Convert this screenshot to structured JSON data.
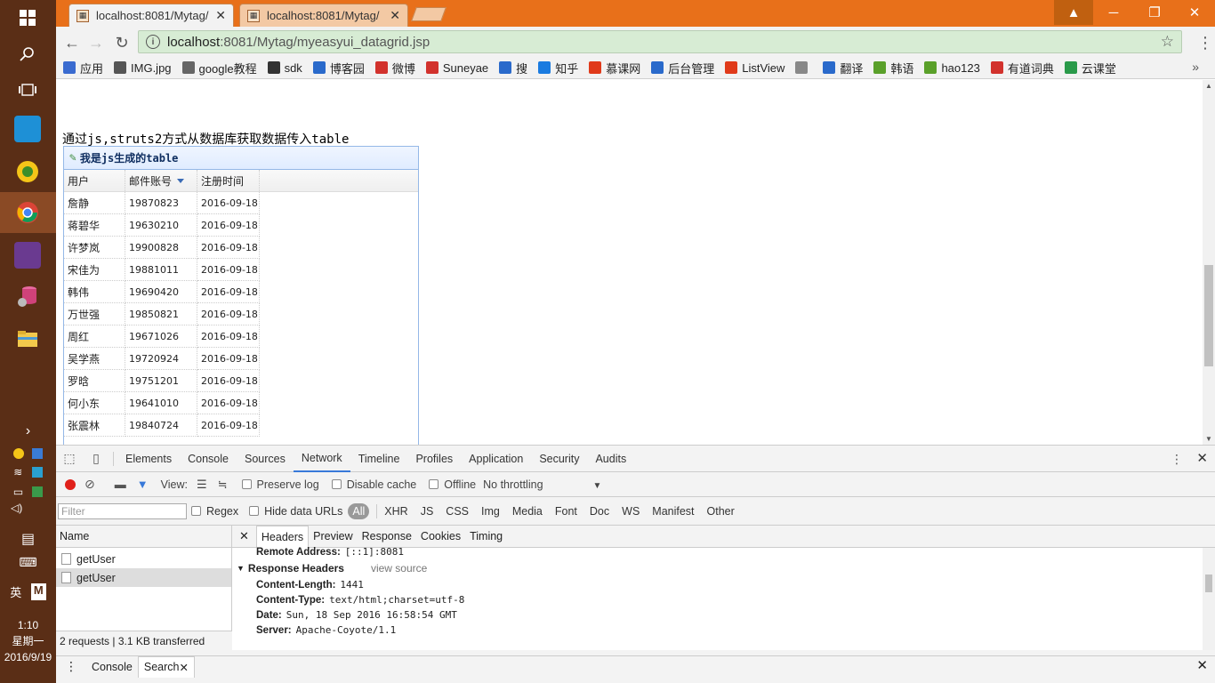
{
  "taskbar": {
    "time": "1:10",
    "weekday": "星期一",
    "date": "2016/9/19",
    "ime": "英",
    "ime2": "M"
  },
  "tabs": [
    {
      "title": "localhost:8081/Mytag/"
    },
    {
      "title": "localhost:8081/Mytag/"
    }
  ],
  "address": {
    "host": "localhost",
    "path": ":8081/Mytag/myeasyui_datagrid.jsp"
  },
  "bookmarks": [
    {
      "label": "应用",
      "color": "#3a6bd0"
    },
    {
      "label": "IMG.jpg",
      "color": "#555555"
    },
    {
      "label": "google教程",
      "color": "#666666"
    },
    {
      "label": "sdk",
      "color": "#333333"
    },
    {
      "label": "博客园",
      "color": "#2a6acb"
    },
    {
      "label": "微博",
      "color": "#d2322d"
    },
    {
      "label": "Suneyae",
      "color": "#d2322d"
    },
    {
      "label": "搜",
      "color": "#2a6acb"
    },
    {
      "label": "知乎",
      "color": "#1a7be0"
    },
    {
      "label": "慕课网",
      "color": "#e03a1a"
    },
    {
      "label": "后台管理",
      "color": "#2a6acb"
    },
    {
      "label": "ListView",
      "color": "#e03a1a"
    },
    {
      "label": "",
      "color": "#888888"
    },
    {
      "label": "翻译",
      "color": "#2a6acb"
    },
    {
      "label": "韩语",
      "color": "#5aa02a"
    },
    {
      "label": "hao123",
      "color": "#5aa02a"
    },
    {
      "label": "有道词典",
      "color": "#d2322d"
    },
    {
      "label": "云课堂",
      "color": "#2a9a4a"
    }
  ],
  "page": {
    "heading": "通过js,struts2方式从数据库获取数据传入table",
    "panel_title": "我是js生成的table",
    "columns": [
      "用户",
      "邮件账号",
      "注册时间"
    ],
    "rows": [
      [
        "詹静",
        "19870823",
        "2016-09-18"
      ],
      [
        "蒋碧华",
        "19630210",
        "2016-09-18"
      ],
      [
        "许梦岚",
        "19900828",
        "2016-09-18"
      ],
      [
        "宋佳为",
        "19881011",
        "2016-09-18"
      ],
      [
        "韩伟",
        "19690420",
        "2016-09-18"
      ],
      [
        "万世强",
        "19850821",
        "2016-09-18"
      ],
      [
        "周红",
        "19671026",
        "2016-09-18"
      ],
      [
        "吴学燕",
        "19720924",
        "2016-09-18"
      ],
      [
        "罗晗",
        "19751201",
        "2016-09-18"
      ],
      [
        "何小东",
        "19641010",
        "2016-09-18"
      ],
      [
        "张震林",
        "19840724",
        "2016-09-18"
      ]
    ]
  },
  "devtools": {
    "tabs": [
      "Elements",
      "Console",
      "Sources",
      "Network",
      "Timeline",
      "Profiles",
      "Application",
      "Security",
      "Audits"
    ],
    "active_tab": "Network",
    "view_label": "View:",
    "preserve_log": "Preserve log",
    "disable_cache": "Disable cache",
    "offline": "Offline",
    "throttling": "No throttling",
    "filter_placeholder": "Filter",
    "regex": "Regex",
    "hide_data_urls": "Hide data URLs",
    "all": "All",
    "filter_types": [
      "XHR",
      "JS",
      "CSS",
      "Img",
      "Media",
      "Font",
      "Doc",
      "WS",
      "Manifest",
      "Other"
    ],
    "name_header": "Name",
    "requests": [
      "getUser",
      "getUser"
    ],
    "summary": "2 requests | 3.1 KB transferred",
    "detail_tabs": [
      "Headers",
      "Preview",
      "Response",
      "Cookies",
      "Timing"
    ],
    "remote_address_label": "Remote Address:",
    "remote_address": "[::1]:8081",
    "response_headers_title": "Response Headers",
    "view_source": "view source",
    "headers": [
      {
        "k": "Content-Length:",
        "v": "1441"
      },
      {
        "k": "Content-Type:",
        "v": "text/html;charset=utf-8"
      },
      {
        "k": "Date:",
        "v": "Sun, 18 Sep 2016 16:58:54 GMT"
      },
      {
        "k": "Server:",
        "v": "Apache-Coyote/1.1"
      }
    ],
    "drawer_tabs": [
      "Console",
      "Search"
    ]
  }
}
